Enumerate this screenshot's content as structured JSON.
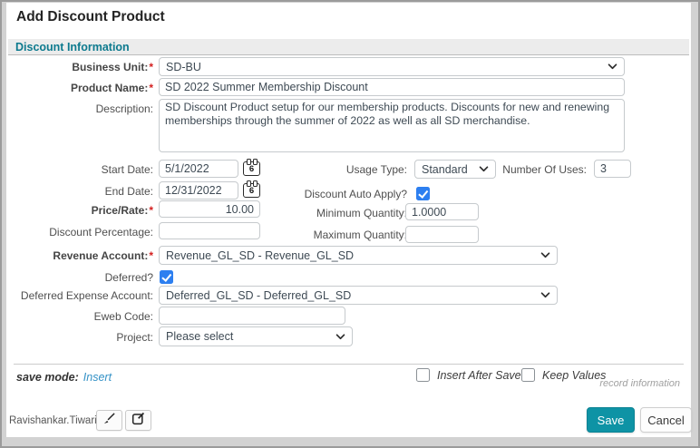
{
  "page": {
    "title": "Add Discount Product"
  },
  "section": {
    "title": "Discount Information"
  },
  "fields": {
    "business_unit": {
      "label": "Business Unit:",
      "required": "*",
      "value": "SD-BU"
    },
    "product_name": {
      "label": "Product Name:",
      "required": "*",
      "value": "SD 2022 Summer Membership Discount"
    },
    "description": {
      "label": "Description:",
      "value": "SD Discount Product setup for our membership products. Discounts for new and renewing memberships through the summer of 2022 as well as all SD merchandise."
    },
    "start_date": {
      "label": "Start Date:",
      "value": "5/1/2022",
      "icon_day": "6"
    },
    "usage_type": {
      "label": "Usage Type:",
      "value": "Standard"
    },
    "number_of_uses": {
      "label": "Number Of Uses:",
      "value": "3"
    },
    "end_date": {
      "label": "End Date:",
      "value": "12/31/2022",
      "icon_day": "6"
    },
    "discount_auto_apply": {
      "label": "Discount Auto Apply?",
      "checked": true
    },
    "price_rate": {
      "label": "Price/Rate:",
      "required": "*",
      "value": "10.00"
    },
    "minimum_quantity": {
      "label": "Minimum Quantity:",
      "value": "1.0000"
    },
    "discount_percentage": {
      "label": "Discount Percentage:",
      "value": ""
    },
    "maximum_quantity": {
      "label": "Maximum Quantity:",
      "value": ""
    },
    "revenue_account": {
      "label": "Revenue Account:",
      "required": "*",
      "value": "Revenue_GL_SD - Revenue_GL_SD"
    },
    "deferred": {
      "label": "Deferred?",
      "checked": true
    },
    "deferred_expense_account": {
      "label": "Deferred Expense Account:",
      "value": "Deferred_GL_SD - Deferred_GL_SD"
    },
    "eweb_code": {
      "label": "Eweb Code:",
      "value": ""
    },
    "project": {
      "label": "Project:",
      "value": "Please select"
    }
  },
  "footer": {
    "save_mode_label": "save mode:",
    "save_mode_value": "Insert",
    "insert_after_save": {
      "label": "Insert After Save",
      "checked": false
    },
    "keep_values": {
      "label": "Keep Values",
      "checked": false
    },
    "record_information": "record information",
    "user": "Ravishankar.Tiwari",
    "save_label": "Save",
    "cancel_label": "Cancel"
  },
  "colors": {
    "section_title": "#0d7a8e",
    "save_button": "#0e93a5",
    "checkbox_checked": "#2d7ff0",
    "required_asterisk": "#d42020",
    "link_blue": "#3391c6"
  }
}
